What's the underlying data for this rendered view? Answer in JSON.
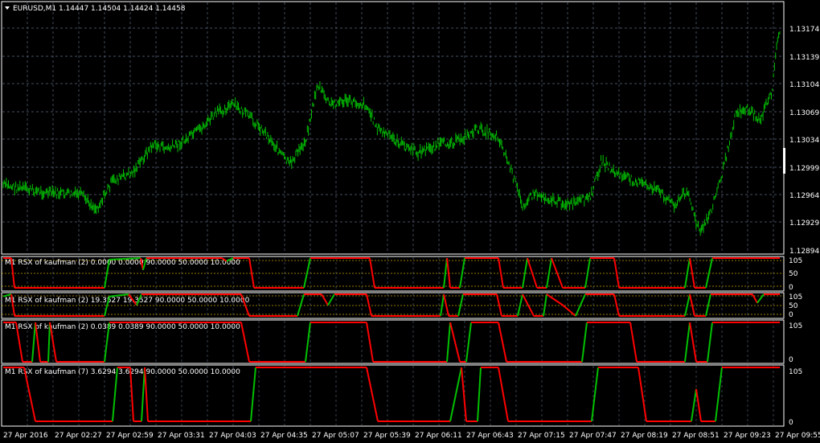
{
  "main": {
    "title": "EURUSD,M1  1.14447 1.14504 1.14424 1.14458",
    "price_labels": [
      "1.13174",
      "1.13139",
      "1.13104",
      "1.13069",
      "1.13034",
      "1.12999",
      "1.12964",
      "1.12929",
      "1.12894"
    ],
    "candle_color": "#00c000",
    "grid_color": "#5a6a80"
  },
  "indicators": [
    {
      "title": "M1  RSX of kaufman (2) 0.0000 0.0000 90.0000 50.0000 10.0000",
      "axis_labels": [
        "105",
        "50",
        "0"
      ]
    },
    {
      "title": "M1  RSX of kaufman (2) 19.3527 19.3527 90.0000 50.0000 10.0000",
      "axis_labels": [
        "105",
        "50",
        "0"
      ]
    },
    {
      "title": "M1  RSX of kaufman (2) 0.0389 0.0389 90.0000 50.0000 10.0000",
      "axis_labels": [
        "105",
        "0"
      ]
    },
    {
      "title": "M1  RSX of kaufman (7) 3.6294 3.6294 90.0000 50.0000 10.0000",
      "axis_labels": [
        "105",
        "0"
      ]
    }
  ],
  "time_labels": [
    "27 Apr 2016",
    "27 Apr 02:27",
    "27 Apr 02:59",
    "27 Apr 03:31",
    "27 Apr 04:03",
    "27 Apr 04:35",
    "27 Apr 05:07",
    "27 Apr 05:39",
    "27 Apr 06:11",
    "27 Apr 06:43",
    "27 Apr 07:15",
    "27 Apr 07:47",
    "27 Apr 08:19",
    "27 Apr 08:51",
    "27 Apr 09:23",
    "27 Apr 09:55"
  ],
  "colors": {
    "up": "#00c000",
    "down": "#ff0000",
    "level_line": "#c8a000",
    "frame": "#ffffff"
  }
}
